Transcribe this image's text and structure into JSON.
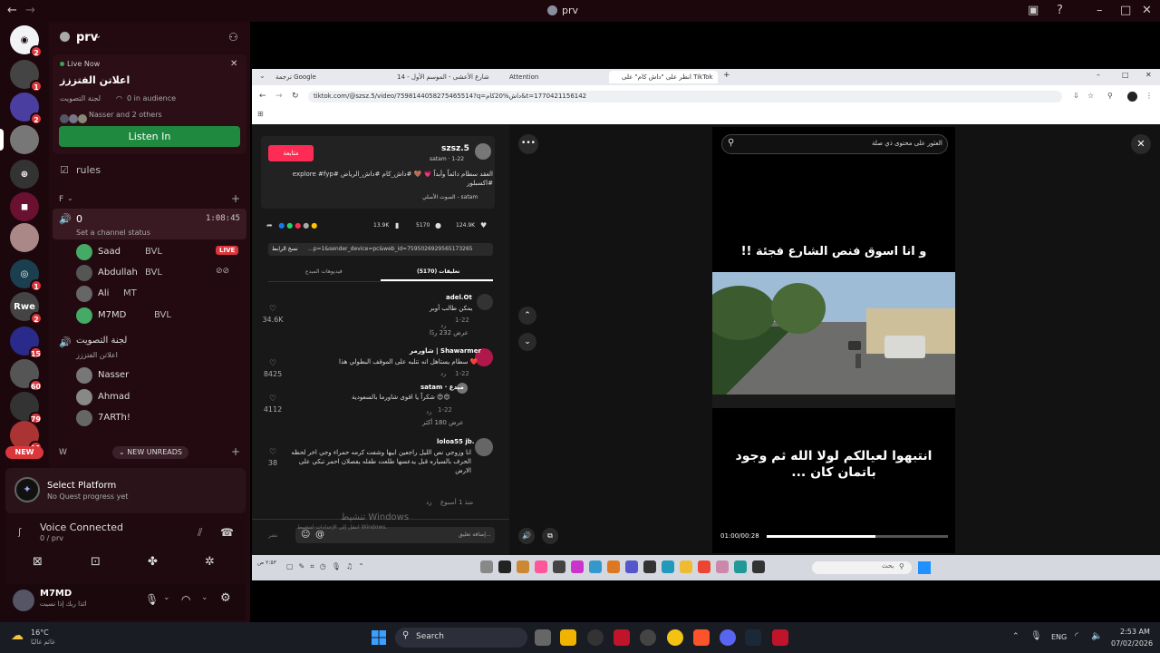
{
  "window": {
    "title": "prv"
  },
  "servers": [
    {
      "badge": "2"
    },
    {
      "badge": "1"
    },
    {
      "badge": "2"
    },
    {
      "badge": ""
    },
    {
      "badge": ""
    },
    {
      "badge": ""
    },
    {
      "badge": ""
    },
    {
      "badge": "1"
    },
    {
      "label": "Rwe",
      "badge": "2"
    },
    {
      "badge": "15"
    },
    {
      "badge": "60"
    },
    {
      "badge": "79"
    },
    {
      "badge": "11"
    }
  ],
  "new_label": "NEW",
  "guild": {
    "name": "prv"
  },
  "live": {
    "status": "Live Now",
    "title": "اعلاتن الفتززز",
    "channel": "لجنة التصويت",
    "audience": "0 in audience",
    "participants": "Nasser and 2 others",
    "listen_label": "Listen In"
  },
  "channels": {
    "rules": "rules",
    "category_f": "F",
    "voice_channel": "0",
    "timer": "1:08:45",
    "set_status": "Set a channel status",
    "users": [
      {
        "name": "Saad",
        "tag": "BVL",
        "live": "LIVE"
      },
      {
        "name": "Abdullah",
        "tag": "BVL"
      },
      {
        "name": "Ali",
        "tag": "MT"
      },
      {
        "name": "M7MD",
        "tag": "BVL"
      }
    ],
    "voice2": "لجنة التصويت",
    "voice2_status": "اعلاتن الفتززز",
    "voice2_users": [
      "Nasser",
      "Ahmad",
      "7ARTh!"
    ],
    "category_w": "W",
    "new_unreads": "NEW UNREADS"
  },
  "quest": {
    "title": "Select Platform",
    "subtitle": "No Quest progress yet"
  },
  "voice": {
    "title": "Voice Connected",
    "sub": "0 / prv"
  },
  "user": {
    "name": "M7MD",
    "status": "ائذا ربك إذا نسيت"
  },
  "browser": {
    "tabs": [
      "ترجمة Google",
      "شارع الأعشى - الموسم الأول - 14",
      "Attention",
      "انظر على \"داش كام\" على TikTok"
    ],
    "url": "tiktok.com/@szsz.5/video/7598144058275465514?q=داش%20كام&t=1770421156142"
  },
  "tiktok": {
    "follow": "متابعة",
    "author": "szsz.5",
    "author_sub": "satam · 1-22",
    "caption": "العقد سطام دائماً وأبداً 💗 🤎 #داش_كام #داش_الرياض #explore #fyp #اكسبلور",
    "sound": "الصوت الأصلي - satam",
    "likes": "124.9K",
    "comments_count": "5170",
    "saves": "13.9K",
    "copy_link": "نسخ الرابط",
    "link": "...p=1&sender_device=pc&web_id=7595026929565173265",
    "tab_comments": "تعليقات (5170)",
    "tab_creator": "فيديوهات المبدع",
    "comments": [
      {
        "name": "adel.Ot",
        "text": "يمكن طالب أوبر",
        "date": "1-22",
        "reply": "رد",
        "likes": "34.6K",
        "more": "عرض 232 ردًا"
      },
      {
        "name": "شاورمر | Shawarmer",
        "text": "سطام يستاهل انه نتلبه على الموقف البطولي هذا ❤️",
        "date": "1-22",
        "reply": "رد",
        "likes": "8425"
      },
      {
        "name": "satam · مبدع",
        "text": "شكراً يا اقوى شاورما بالسعودية 😍😍",
        "date": "1-22",
        "reply": "رد",
        "likes": "4112",
        "more": "عرض 180 أكثر"
      },
      {
        "name": "loloa55 jb.",
        "text": "انا وزوجي نص الليل راجعين ابيها وشفت كرمه حمراء وجي اخر لحظه الحرف بالسياره قبل يدعسها طلعت طفله يفصلان احمر تبكي على الارض",
        "date": "منذ 1 أسبوع",
        "reply": "رد",
        "likes": "38"
      }
    ],
    "comment_placeholder": "إضافة تعليق...",
    "post": "نشر",
    "search_placeholder": "العثور على محتوى ذي صلة",
    "overlay_top": "و انا اسوق فنص الشارع فجئة !!",
    "overlay_bottom": "انتبهوا لعيالكم لولا الله ثم وجود باتمان كان ...",
    "time": "01:00/00:28",
    "progress": 0.6,
    "windows_line1": "تنشيط Windows",
    "windows_line2": "انتقل إلى الإعدادات لتنشيط Windows."
  },
  "inner_taskbar": {
    "search": "بحث",
    "clock": "٢:٥٣ ص"
  },
  "taskbar": {
    "weather_temp": "16°C",
    "weather_desc": "غائم غالبًا",
    "search": "Search",
    "lang": "ENG",
    "time": "2:53 AM",
    "date": "07/02/2026"
  }
}
